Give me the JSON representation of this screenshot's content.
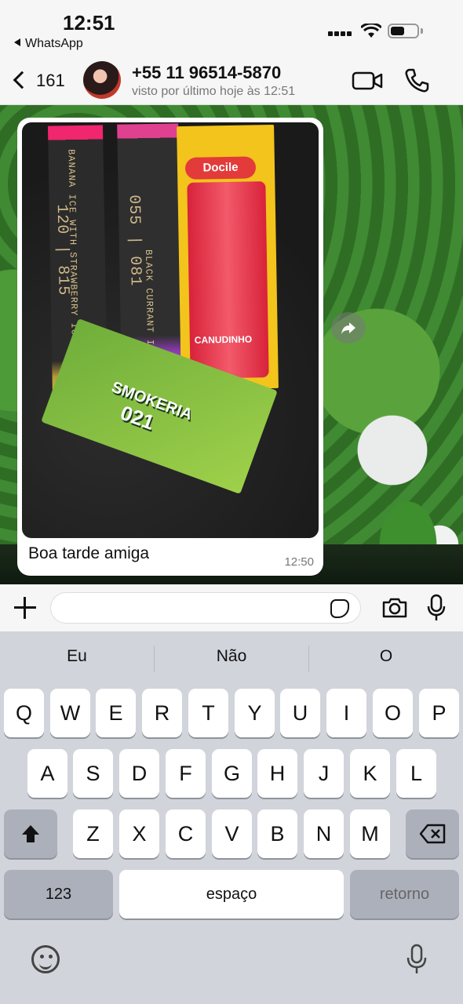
{
  "status_bar": {
    "time": "12:51",
    "back_app": "WhatsApp"
  },
  "header": {
    "back_count": "161",
    "contact_name": "+55 11 96514-5870",
    "last_seen": "visto por último hoje às 12:51"
  },
  "message": {
    "photo_texts": {
      "box1_flavor": "BANANA ICE WITH STRAWBERRY ICE MIX",
      "box1_numbers": "120 | 815",
      "box2_flavor": "BLACK CURRANT ICE",
      "box2_numbers": "055 | 081",
      "straw_brand": "Docile",
      "straw_label": "CANUDINHO",
      "card_line1": "SMOKERIA",
      "card_line2": "021"
    },
    "text": "Boa tarde amiga",
    "time": "12:50"
  },
  "input": {
    "placeholder": ""
  },
  "keyboard": {
    "suggestions": [
      "Eu",
      "Não",
      "O"
    ],
    "rows": [
      [
        "Q",
        "W",
        "E",
        "R",
        "T",
        "Y",
        "U",
        "I",
        "O",
        "P"
      ],
      [
        "A",
        "S",
        "D",
        "F",
        "G",
        "H",
        "J",
        "K",
        "L"
      ],
      [
        "Z",
        "X",
        "C",
        "V",
        "B",
        "N",
        "M"
      ]
    ],
    "numbers_key": "123",
    "space_key": "espaço",
    "return_key": "retorno"
  },
  "icons": {
    "video_call": "video-camera-icon",
    "voice_call": "phone-icon",
    "attach": "plus-icon",
    "sticker": "sticker-icon",
    "camera": "camera-icon",
    "mic": "microphone-icon",
    "forward": "forward-icon",
    "shift": "shift-arrow-icon",
    "backspace": "backspace-icon",
    "emoji": "emoji-icon",
    "dictation": "microphone-icon"
  },
  "colors": {
    "chat_wallpaper": "#2f6d25",
    "bubble": "#ffffff",
    "keyboard_bg": "#d1d4da"
  }
}
